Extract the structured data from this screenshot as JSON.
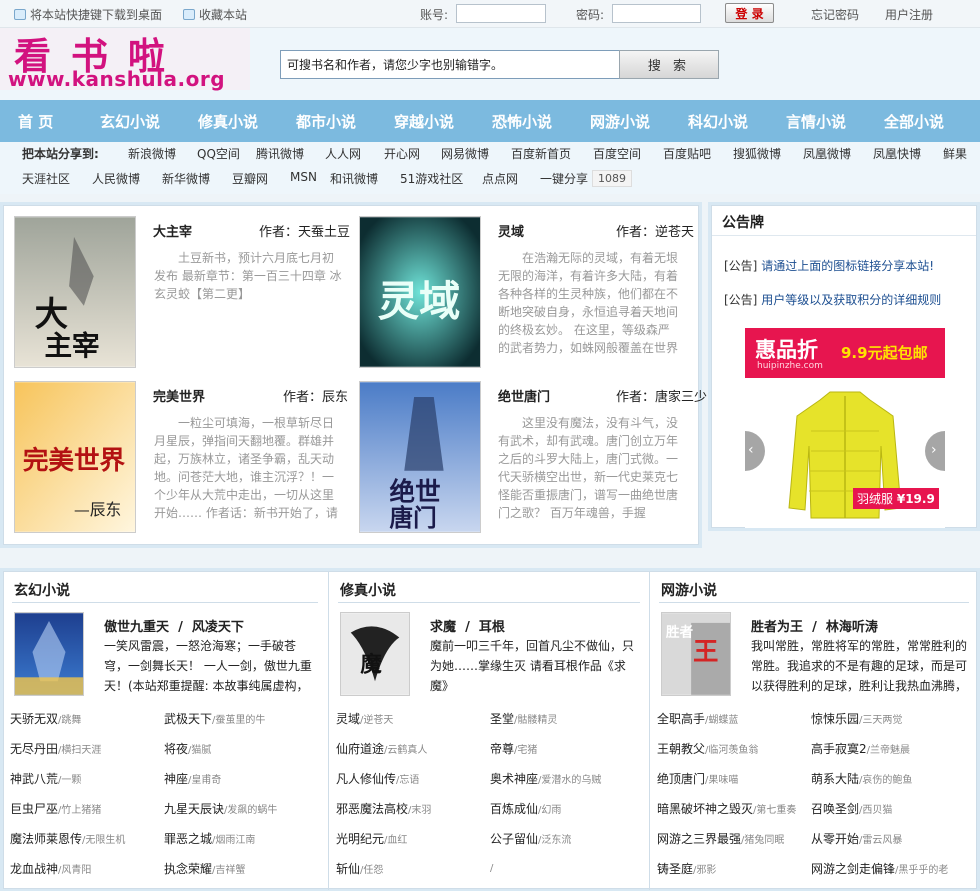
{
  "topbar": {
    "shortcut": "将本站快捷键下载到桌面",
    "favorite": "收藏本站",
    "account_label": "账号:",
    "password_label": "密码:",
    "login_button": "登 录",
    "forgot": "忘记密码",
    "register": "用户注册"
  },
  "logo": {
    "cn": "看书啦",
    "url": "www.kanshula.org"
  },
  "search": {
    "value": "可搜书名和作者，请您少字也别输错字。",
    "button": "搜 索"
  },
  "nav": [
    "首  页",
    "玄幻小说",
    "修真小说",
    "都市小说",
    "穿越小说",
    "恐怖小说",
    "网游小说",
    "科幻小说",
    "言情小说",
    "全部小说"
  ],
  "share": {
    "label": "把本站分享到:",
    "row1": [
      "新浪微博",
      "QQ空间",
      "腾讯微博",
      "人人网",
      "开心网",
      "网易微博",
      "百度新首页",
      "百度空间",
      "百度贴吧",
      "搜狐微博",
      "凤凰微博",
      "凤凰快博",
      "鲜果"
    ],
    "row2": [
      "天涯社区",
      "人民微博",
      "新华微博",
      "豆瓣网",
      "MSN",
      "和讯微博",
      "51游戏社区",
      "点点网",
      "一键分享"
    ],
    "count": "1089"
  },
  "featured": [
    {
      "title": "大主宰",
      "author": "作者：天蚕土豆",
      "desc": "土豆新书，预计六月底七月初发布 最新章节：第一百三十四章 冰玄灵蛟【第二更】",
      "cover": "大主宰"
    },
    {
      "title": "灵域",
      "author": "作者：逆苍天",
      "desc": "在浩瀚无际的灵域，有着无垠无限的海洋，有着许多大陆，有着各种各样的生灵种族，他们都在不断地突破自身，永恒追寻着天地间的终极玄妙。 在这里，等级森严的武者势力，如蛛网般覆盖在世界上",
      "cover": "灵域"
    },
    {
      "title": "完美世界",
      "author": "作者：辰东",
      "desc": "一粒尘可填海，一根草斩尽日月星辰，弹指间天翻地覆。群雄并起，万族林立，诸圣争霸，乱天动地。问苍茫大地，谁主沉浮？！一个少年从大荒中走出，一切从这里开始…… 作者话：新书开始了，请",
      "cover": "完美世界"
    },
    {
      "title": "绝世唐门",
      "author": "作者：唐家三少",
      "desc": "这里没有魔法，没有斗气，没有武术，却有武魂。唐门创立万年之后的斗罗大陆上，唐门式微。一代天骄横空出世，新一代史莱克七怪能否重振唐门，谱写一曲绝世唐门之歌？ 百万年魂兽，手握",
      "cover": "绝世唐门"
    }
  ],
  "notice": {
    "title": "公告牌",
    "items": [
      {
        "tag": "[公告]",
        "text": "请通过上面的图标链接分享本站!"
      },
      {
        "tag": "[公告]",
        "text": "用户等级以及获取积分的详细规则"
      }
    ],
    "ad": {
      "brand": "惠品折",
      "domain": "huipinzhe.com",
      "price_tag": "9.9元起包邮",
      "item": "羽绒服",
      "price": "¥19.9"
    }
  },
  "sections": [
    {
      "title": "玄幻小说",
      "feature": {
        "title": "傲世九重天",
        "author": "风凌天下",
        "desc": "一笑风雷震，一怒沧海寒；一手破苍穹，一剑舞长天！ 一人一剑，傲世九重天！(本站郑重提醒: 本故事纯属虚构，如有"
      },
      "list": [
        [
          "天骄无双",
          "/跳舞"
        ],
        [
          "武极天下",
          "/蚕茧里的牛"
        ],
        [
          "无尽丹田",
          "/横扫天涯"
        ],
        [
          "将夜",
          "/猫腻"
        ],
        [
          "神武八荒",
          "/一颗"
        ],
        [
          "神座",
          "/皇甫奇"
        ],
        [
          "巨虫尸巫",
          "/竹上猪猪"
        ],
        [
          "九星天辰诀",
          "/发飙的蜗牛"
        ],
        [
          "魔法师莱恩传",
          "/无限生机"
        ],
        [
          "罪恶之城",
          "/烟雨江南"
        ],
        [
          "龙血战神",
          "/风青阳"
        ],
        [
          "执念荣耀",
          "/吉祥蟹"
        ]
      ]
    },
    {
      "title": "修真小说",
      "feature": {
        "title": "求魔",
        "author": "耳根",
        "desc": "魔前一叩三千年，回首凡尘不做仙，只为她……掌缘生灭 请看耳根作品《求魔》"
      },
      "list": [
        [
          "灵域",
          "/逆苍天"
        ],
        [
          "圣堂",
          "/骷髅精灵"
        ],
        [
          "仙府道途",
          "/云鹤真人"
        ],
        [
          "帝尊",
          "/宅猪"
        ],
        [
          "凡人修仙传",
          "/忘语"
        ],
        [
          "奥术神座",
          "/爱潜水的乌贼"
        ],
        [
          "邪恶魔法高校",
          "/末羽"
        ],
        [
          "百炼成仙",
          "/幻雨"
        ],
        [
          "光明纪元",
          "/血红"
        ],
        [
          "公子留仙",
          "/泛东流"
        ],
        [
          "斩仙",
          "/任怨"
        ],
        [
          "",
          "/"
        ]
      ]
    },
    {
      "title": "网游小说",
      "feature": {
        "title": "胜者为王",
        "author": "林海听涛",
        "desc": "我叫常胜，常胜将军的常胜，常常胜利的常胜。我追求的不是有趣的足球，而是可以获得胜利的足球，胜利让我热血沸腾，"
      },
      "list": [
        [
          "全职高手",
          "/蝴蝶蓝"
        ],
        [
          "惊悚乐园",
          "/三天两觉"
        ],
        [
          "王朝教父",
          "/临河羡鱼翁"
        ],
        [
          "高手寂寞2",
          "/兰帝魅晨"
        ],
        [
          "绝顶唐门",
          "/果味喵"
        ],
        [
          "萌系大陆",
          "/哀伤的鲍鱼"
        ],
        [
          "暗黑破坏神之毁灭",
          "/第七重奏"
        ],
        [
          "召唤圣剑",
          "/西贝猫"
        ],
        [
          "网游之三界最强",
          "/猪兔同眠"
        ],
        [
          "从零开始",
          "/雷云风暴"
        ],
        [
          "铸圣庭",
          "/邪影"
        ],
        [
          "网游之剑走偏锋",
          "/黑乎乎的老"
        ]
      ]
    }
  ],
  "colors": {
    "nav": "#7cbadf",
    "logo": "#d2127f",
    "link": "#1d4f91"
  }
}
